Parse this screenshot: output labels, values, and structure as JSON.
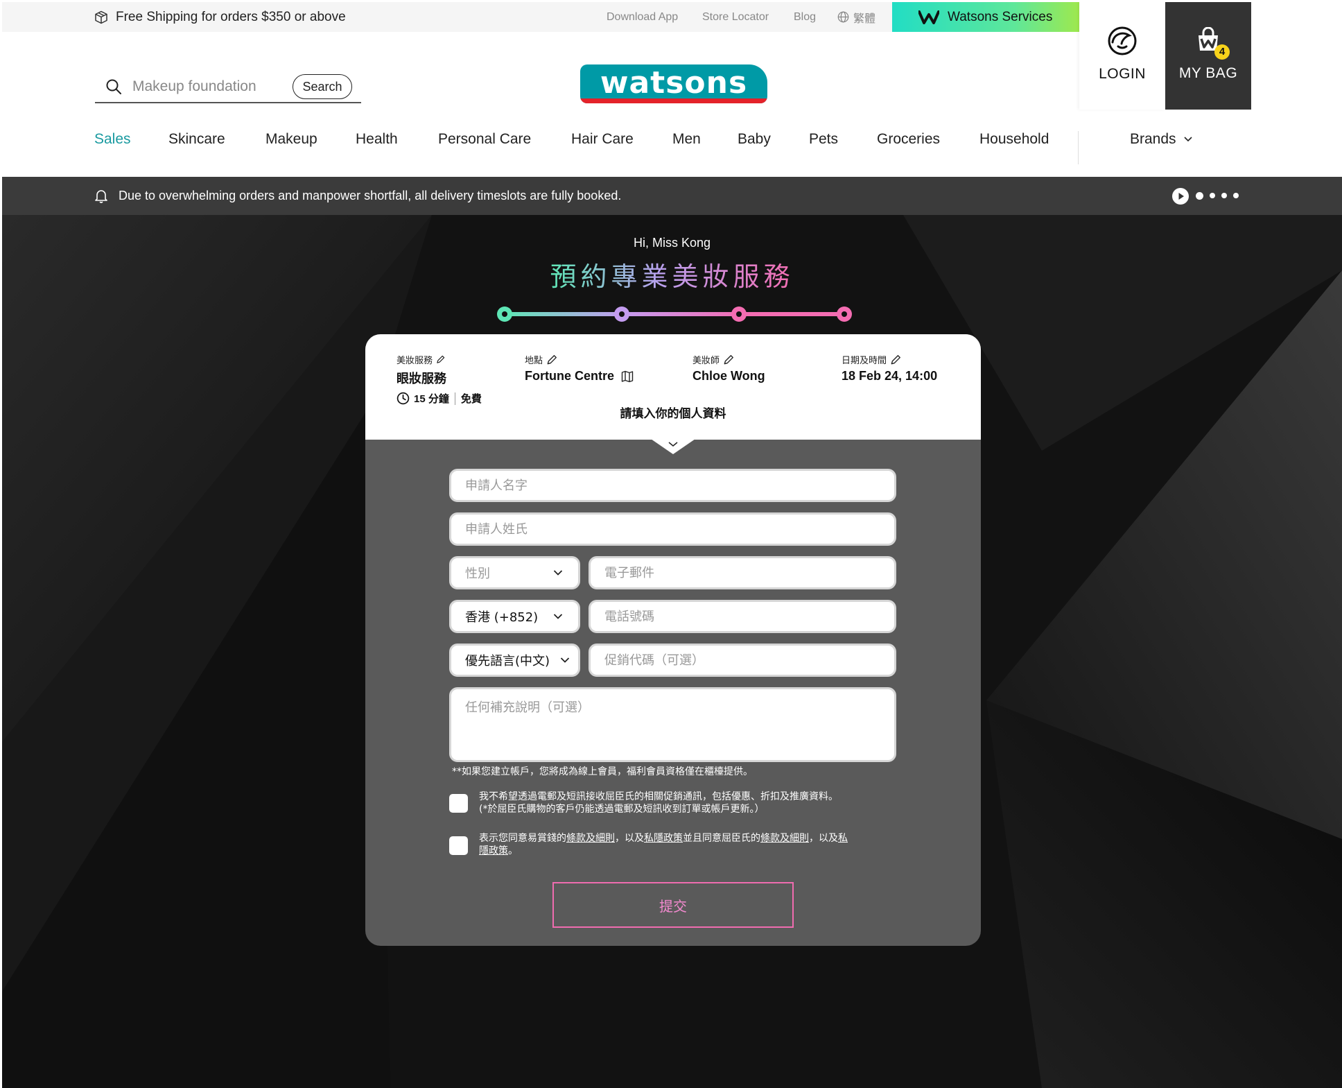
{
  "topbar": {
    "shipping": "Free Shipping for orders $350 or above",
    "links": [
      "Download App",
      "Store Locator",
      "Blog"
    ],
    "language": "繁體",
    "services": "Watsons Services"
  },
  "account": {
    "login_label": "LOGIN",
    "bag_label": "MY BAG",
    "bag_count": "4"
  },
  "search": {
    "placeholder": "Makeup foundation",
    "button": "Search"
  },
  "logo": {
    "text": "watsons"
  },
  "nav": {
    "items": [
      "Sales",
      "Skincare",
      "Makeup",
      "Health",
      "Personal Care",
      "Hair Care",
      "Men",
      "Baby",
      "Pets",
      "Groceries",
      "Household"
    ],
    "active": "Sales",
    "brands": "Brands"
  },
  "notice": {
    "text": "Due to overwhelming orders and manpower shortfall, all delivery timeslots are fully booked."
  },
  "booking": {
    "greeting": "Hi, Miss Kong",
    "title": "預約專業美妝服務",
    "summary": {
      "service_label": "美妝服務",
      "service_value": "眼妝服務",
      "duration": "15 分鐘",
      "price": "免費",
      "location_label": "地點",
      "location_value": "Fortune Centre",
      "artist_label": "美妝師",
      "artist_value": "Chloe Wong",
      "datetime_label": "日期及時間",
      "datetime_value": "18 Feb 24, 14:00"
    },
    "instruction": "請填入你的個人資料",
    "form": {
      "first_name_placeholder": "申請人名字",
      "last_name_placeholder": "申請人姓氏",
      "gender_placeholder": "性別",
      "email_placeholder": "電子郵件",
      "country_code": "香港 (+852)",
      "phone_placeholder": "電話號碼",
      "language_pref": "優先語言(中文)",
      "promo_placeholder": "促銷代碼（可選）",
      "notes_placeholder": "任何補充說明（可選）"
    },
    "member_note": "**如果您建立帳戶，您將成為線上會員，福利會員資格僅在櫃檯提供。",
    "opt_out": {
      "line1": "我不希望透過電郵及短訊接收屈臣氏的相關促銷通訊，包括優惠、折扣及推廣資料。",
      "line2": "(*於屈臣氏購物的客戶仍能透過電郵及短訊收到訂單或帳戶更新。）"
    },
    "terms": {
      "t1": "表示您同意易賞錢的",
      "l1": "條款及細則",
      "t2": "，以及",
      "l2": "私隱政策",
      "t3": "並且同意屈臣氏的",
      "l3": "條款及細則",
      "t4": "，以及",
      "l4a": "私",
      "l4b": "隱政策",
      "t5": "。"
    },
    "submit": "提交"
  },
  "colors": {
    "brand_teal": "#009aa6",
    "brand_red": "#e4222a",
    "active_nav": "#1a9aa0",
    "step_green": "#5ee6b5",
    "step_purple": "#c49cf0",
    "step_pink": "#f46db2"
  }
}
